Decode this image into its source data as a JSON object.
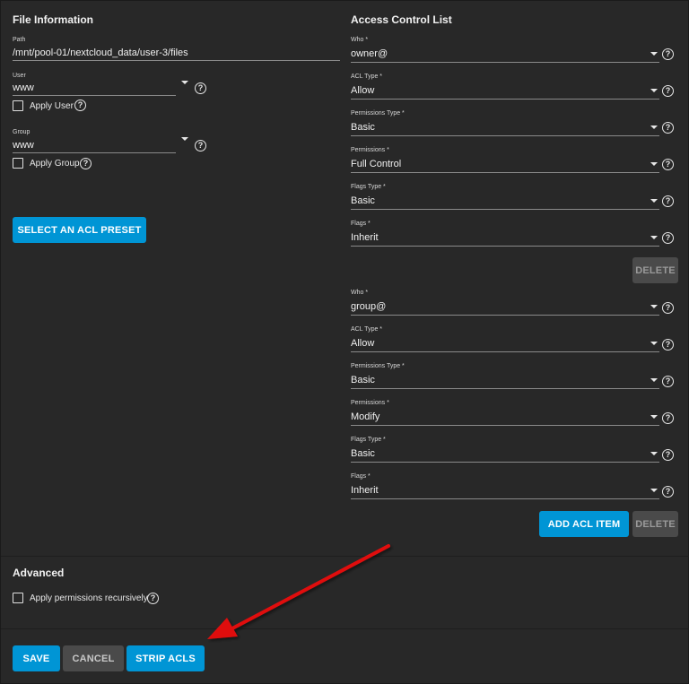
{
  "file_info": {
    "title": "File Information",
    "path_label": "Path",
    "path_value": "/mnt/pool-01/nextcloud_data/user-3/files",
    "user_label": "User",
    "user_value": "www",
    "apply_user_label": "Apply User",
    "group_label": "Group",
    "group_value": "www",
    "apply_group_label": "Apply Group",
    "preset_button": "SELECT AN ACL PRESET"
  },
  "acl": {
    "title": "Access Control List",
    "entries": [
      {
        "who_label": "Who *",
        "who_value": "owner@",
        "acl_type_label": "ACL Type *",
        "acl_type_value": "Allow",
        "perm_type_label": "Permissions Type *",
        "perm_type_value": "Basic",
        "perm_label": "Permissions *",
        "perm_value": "Full Control",
        "flags_type_label": "Flags Type *",
        "flags_type_value": "Basic",
        "flags_label": "Flags *",
        "flags_value": "Inherit",
        "delete_label": "DELETE"
      },
      {
        "who_label": "Who *",
        "who_value": "group@",
        "acl_type_label": "ACL Type *",
        "acl_type_value": "Allow",
        "perm_type_label": "Permissions Type *",
        "perm_type_value": "Basic",
        "perm_label": "Permissions *",
        "perm_value": "Modify",
        "flags_type_label": "Flags Type *",
        "flags_type_value": "Basic",
        "flags_label": "Flags *",
        "flags_value": "Inherit",
        "delete_label": "DELETE"
      }
    ],
    "add_button": "ADD ACL ITEM"
  },
  "advanced": {
    "title": "Advanced",
    "recursive_label": "Apply permissions recursively"
  },
  "footer": {
    "save": "SAVE",
    "cancel": "CANCEL",
    "strip": "STRIP ACLS"
  },
  "icons": {
    "help": "help-circle-icon",
    "dropdown": "caret-down-icon",
    "annotation": "red-arrow"
  },
  "colors": {
    "background": "#282828",
    "primary": "#0095d5",
    "button_grey": "#4a4a4a",
    "arrow": "#e01010"
  }
}
